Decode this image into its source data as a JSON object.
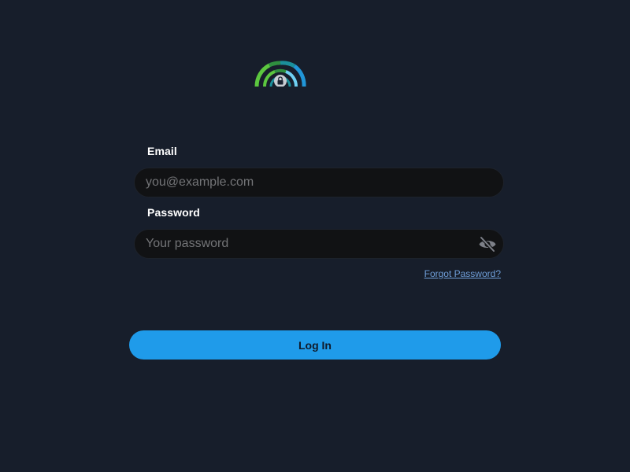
{
  "logo": {
    "icon": "lock-eye-logo-icon",
    "colors": {
      "green_dark": "#2f8f3f",
      "green": "#5cc73f",
      "teal": "#1b8f9b",
      "blue": "#2196d8",
      "light_blue": "#6fd0f2",
      "lock": "#c9cdd3"
    }
  },
  "form": {
    "email": {
      "label": "Email",
      "value": "",
      "placeholder": "you@example.com"
    },
    "password": {
      "label": "Password",
      "value": "",
      "placeholder": "Your password",
      "toggle_icon": "eye-slash-icon"
    },
    "forgot_password": "Forgot Password?",
    "submit_label": "Log In"
  },
  "theme": {
    "background": "#171e2b",
    "input_background": "#111214",
    "accent": "#1f9bea",
    "link": "#6f9ed8"
  }
}
